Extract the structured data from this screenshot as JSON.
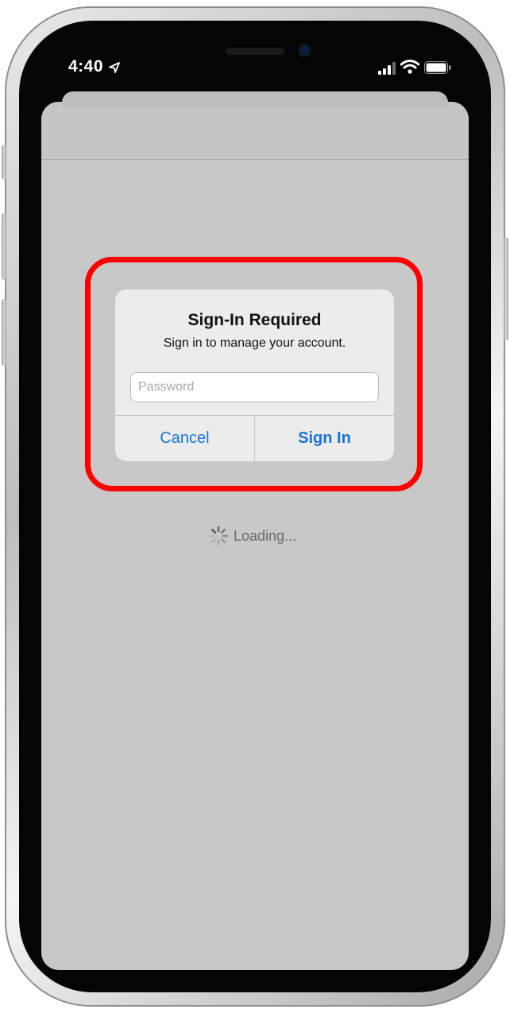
{
  "status_bar": {
    "time": "4:40",
    "location_icon": "location-arrow-icon",
    "signal_icon": "cellular-signal-icon",
    "wifi_icon": "wifi-icon",
    "battery_icon": "battery-icon"
  },
  "alert": {
    "title": "Sign-In Required",
    "message": "Sign in to manage your account.",
    "password_placeholder": "Password",
    "cancel_label": "Cancel",
    "signin_label": "Sign In"
  },
  "loading": {
    "text": "Loading...",
    "icon": "spinner-icon"
  },
  "colors": {
    "highlight": "#ff0000",
    "link_blue": "#1a73d9",
    "screen_bg": "#c8c8c8",
    "alert_bg": "#ececec"
  }
}
